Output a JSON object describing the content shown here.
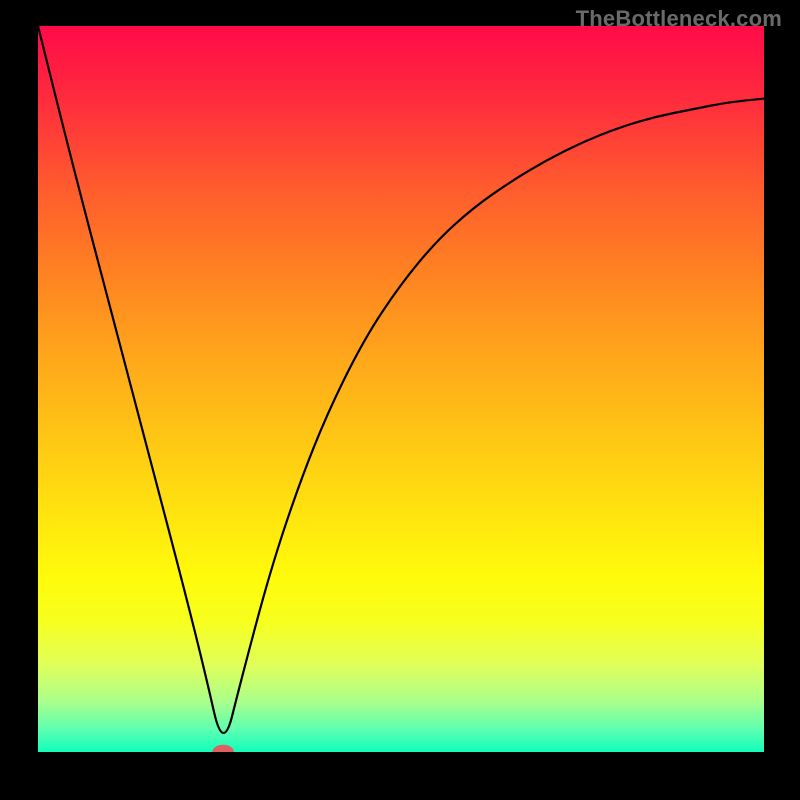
{
  "watermark": "TheBottleneck.com",
  "colors": {
    "background": "#000000",
    "gradient_top": "#ff0b49",
    "gradient_bottom": "#10ffba",
    "curve": "#000000",
    "marker": "#de6060"
  },
  "chart_data": {
    "type": "line",
    "title": "",
    "xlabel": "",
    "ylabel": "",
    "xlim": [
      0,
      100
    ],
    "ylim": [
      0,
      100
    ],
    "legend": false,
    "grid": false,
    "annotations": [],
    "series": [
      {
        "name": "bottleneck-curve",
        "x": [
          0,
          5,
          10,
          15,
          20,
          23,
          25.5,
          28,
          32,
          36,
          40,
          45,
          50,
          55,
          60,
          65,
          70,
          75,
          80,
          85,
          90,
          95,
          100
        ],
        "y": [
          100,
          80,
          61,
          42,
          23,
          11,
          0,
          10,
          25,
          37,
          47,
          57,
          64.5,
          70.5,
          75,
          78.5,
          81.5,
          84,
          86,
          87.5,
          88.5,
          89.5,
          90
        ]
      }
    ],
    "marker": {
      "x": 25.5,
      "y": 0,
      "rx": 1.5,
      "ry": 1.0
    }
  }
}
